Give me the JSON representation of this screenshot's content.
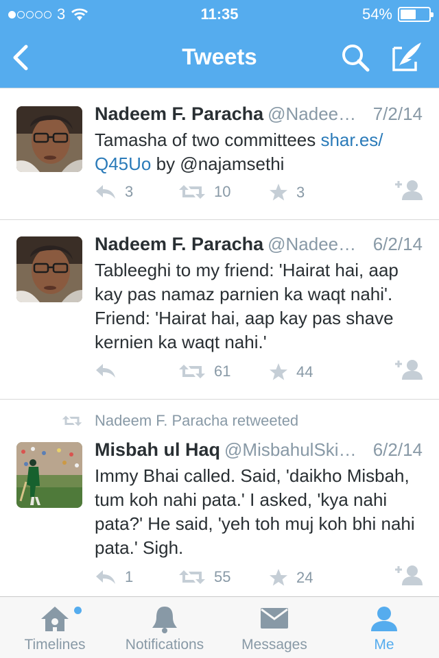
{
  "status_bar": {
    "carrier": "3",
    "time": "11:35",
    "battery": "54%",
    "signal_bars_filled": 1
  },
  "nav": {
    "title": "Tweets",
    "back_icon": "chevron-left-icon",
    "search_icon": "search-icon",
    "compose_icon": "compose-icon"
  },
  "tweets": [
    {
      "name": "Nadeem F. Paracha",
      "handle": "@Nadee…",
      "date": "7/2/14",
      "text_before": "Tamasha of two committees ",
      "link": "shar.es/ Q45Uo",
      "text_after": " by @najamsethi",
      "replies": "3",
      "retweets": "10",
      "favorites": "3"
    },
    {
      "name": "Nadeem F. Paracha",
      "handle": "@Nadee…",
      "date": "6/2/14",
      "text": "Tableeghi to my friend:  'Hairat hai, aap kay pas namaz parnien ka waqt nahi'. Friend: 'Hairat hai, aap kay pas shave kernien ka waqt nahi.'",
      "replies": "",
      "retweets": "61",
      "favorites": "44"
    },
    {
      "retweeted_by": "Nadeem F. Paracha retweeted",
      "name": "Misbah ul Haq",
      "handle": "@MisbahulSki…",
      "date": "6/2/14",
      "text": "Immy Bhai called. Said, 'daikho Misbah, tum koh nahi pata.' I asked, 'kya nahi pata?' He said, 'yeh toh muj koh bhi nahi pata.' Sigh.",
      "replies": "1",
      "retweets": "55",
      "favorites": "24"
    }
  ],
  "tabs": [
    {
      "label": "Timelines",
      "icon": "home-icon",
      "has_badge": true
    },
    {
      "label": "Notifications",
      "icon": "bell-icon",
      "has_badge": false
    },
    {
      "label": "Messages",
      "icon": "envelope-icon",
      "has_badge": false
    },
    {
      "label": "Me",
      "icon": "person-icon",
      "active": true
    }
  ],
  "colors": {
    "brand_blue": "#55acee",
    "link_blue": "#2b7bb9",
    "muted_gray": "#8899a6",
    "text_dark": "#292f33"
  }
}
